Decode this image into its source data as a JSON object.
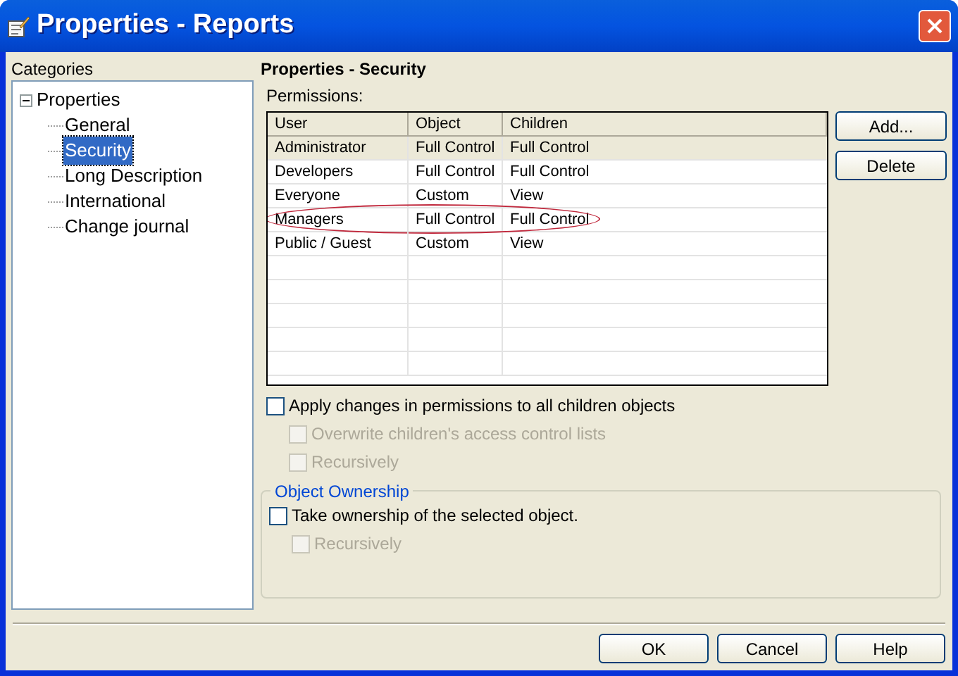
{
  "window": {
    "title": "Properties - Reports"
  },
  "categories": {
    "label": "Categories",
    "tree": [
      {
        "label": "Properties",
        "expanded": true,
        "selected": false,
        "children": [
          {
            "label": "General",
            "selected": false
          },
          {
            "label": "Security",
            "selected": true
          },
          {
            "label": "Long Description",
            "selected": false
          },
          {
            "label": "International",
            "selected": false
          },
          {
            "label": "Change journal",
            "selected": false
          }
        ]
      }
    ]
  },
  "section_title": "Properties - Security",
  "permissions": {
    "label": "Permissions:",
    "columns": [
      "User",
      "Object",
      "Children"
    ],
    "rows": [
      {
        "cells": [
          "Administrator",
          "Full Control",
          "Full Control"
        ],
        "selected": true,
        "circled": false
      },
      {
        "cells": [
          "Developers",
          "Full Control",
          "Full Control"
        ],
        "selected": false,
        "circled": false
      },
      {
        "cells": [
          "Everyone",
          "Custom",
          "View"
        ],
        "selected": false,
        "circled": false
      },
      {
        "cells": [
          "Managers",
          "Full Control",
          "Full Control"
        ],
        "selected": false,
        "circled": true
      },
      {
        "cells": [
          "Public / Guest",
          "Custom",
          "View"
        ],
        "selected": false,
        "circled": false
      }
    ]
  },
  "side_buttons": [
    "Add...",
    "Delete"
  ],
  "options": [
    {
      "label": "Apply changes in permissions to all children objects",
      "checked": false,
      "disabled": false,
      "indented": false
    },
    {
      "label": "Overwrite children's access control lists",
      "checked": false,
      "disabled": true,
      "indented": true
    },
    {
      "label": "Recursively",
      "checked": false,
      "disabled": true,
      "indented": true
    }
  ],
  "ownership": {
    "title": "Object Ownership",
    "options": [
      {
        "label": "Take ownership of the selected object.",
        "checked": false,
        "disabled": false,
        "indented": false
      },
      {
        "label": "Recursively",
        "checked": false,
        "disabled": true,
        "indented": true
      }
    ]
  },
  "buttons": [
    "OK",
    "Cancel",
    "Help"
  ]
}
